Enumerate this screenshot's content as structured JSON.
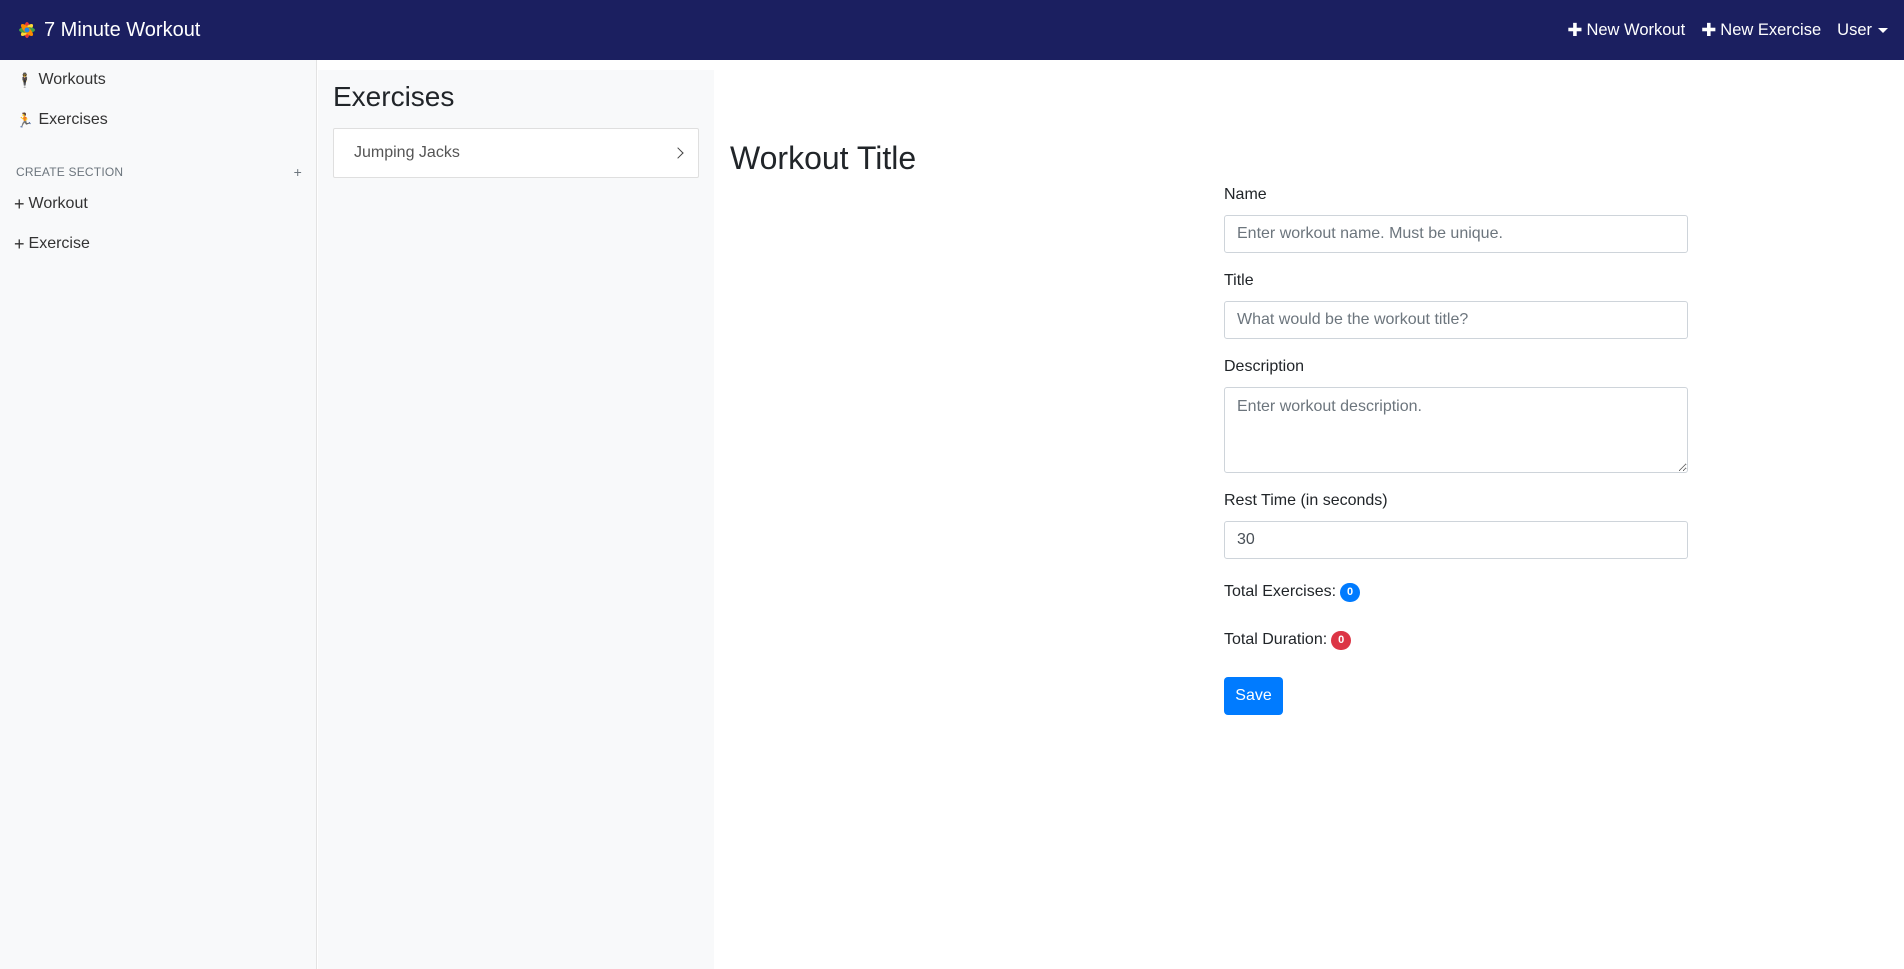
{
  "app": {
    "title": "7 Minute Workout"
  },
  "navbar": {
    "new_workout": "New Workout",
    "new_exercise": "New Exercise",
    "user": "User"
  },
  "sidebar": {
    "items": [
      {
        "label": "Workouts",
        "icon": "person-standing-icon"
      },
      {
        "label": "Exercises",
        "icon": "person-running-icon"
      }
    ],
    "create_heading": "CREATE SECTION",
    "create_items": [
      {
        "label": "Workout"
      },
      {
        "label": "Exercise"
      }
    ]
  },
  "exercises_panel": {
    "title": "Exercises",
    "items": [
      {
        "label": "Jumping Jacks"
      }
    ]
  },
  "main": {
    "title": "Workout Title",
    "form": {
      "name_label": "Name",
      "name_placeholder": "Enter workout name. Must be unique.",
      "title_label": "Title",
      "title_placeholder": "What would be the workout title?",
      "description_label": "Description",
      "description_placeholder": "Enter workout description.",
      "rest_label": "Rest Time (in seconds)",
      "rest_value": "30",
      "total_exercises_label": "Total Exercises:",
      "total_exercises_value": "0",
      "total_duration_label": "Total Duration:",
      "total_duration_value": "0",
      "save_label": "Save"
    }
  },
  "colors": {
    "navbar": "#1b1f60",
    "primary": "#007bff",
    "danger": "#dc3545"
  }
}
